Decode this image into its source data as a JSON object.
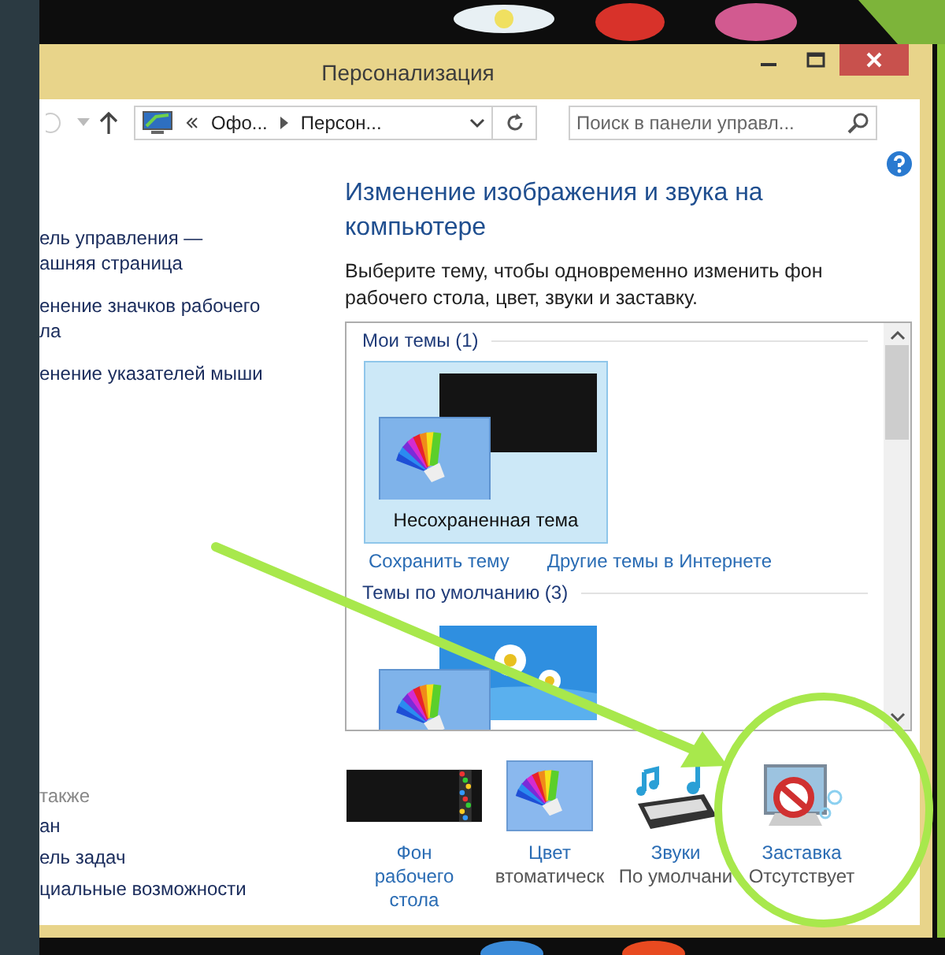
{
  "window": {
    "title": "Персонализация"
  },
  "address_bar": {
    "segments": [
      "Офо...",
      "Персон..."
    ]
  },
  "search": {
    "placeholder": "Поиск в панели управл..."
  },
  "sidebar": {
    "links": [
      {
        "lines": [
          "ель управления —",
          "ашняя страница"
        ]
      },
      {
        "lines": [
          "енение значков рабочего",
          "ла"
        ]
      },
      {
        "lines": [
          "енение указателей мыши"
        ]
      }
    ],
    "see_also": {
      "heading": "также",
      "links": [
        "ан",
        "ель задач",
        "циальные возможности"
      ]
    }
  },
  "heading": "Изменение изображения и звука на компьютере",
  "description": "Выберите тему, чтобы одновременно изменить фон рабочего стола, цвет, звуки и заставку.",
  "theme_groups": [
    {
      "header": "Мои темы (1)",
      "themes": [
        {
          "kind": "dark",
          "label": "Несохраненная тема",
          "selected": true
        }
      ],
      "links": [
        "Сохранить тему",
        "Другие темы в Интернете"
      ]
    },
    {
      "header": "Темы по умолчанию (3)",
      "themes": [
        {
          "kind": "daisy",
          "selected": false
        }
      ]
    }
  ],
  "settings": [
    {
      "kind": "background",
      "lines": [
        "Фон",
        "рабочего",
        "стола"
      ]
    },
    {
      "kind": "color",
      "lines": [
        "Цвет"
      ],
      "value": "втоматическ"
    },
    {
      "kind": "sounds",
      "lines": [
        "Звуки"
      ],
      "value": "По умолчани"
    },
    {
      "kind": "screensaver",
      "lines": [
        "Заставка"
      ],
      "value": "Отсутствует"
    }
  ]
}
